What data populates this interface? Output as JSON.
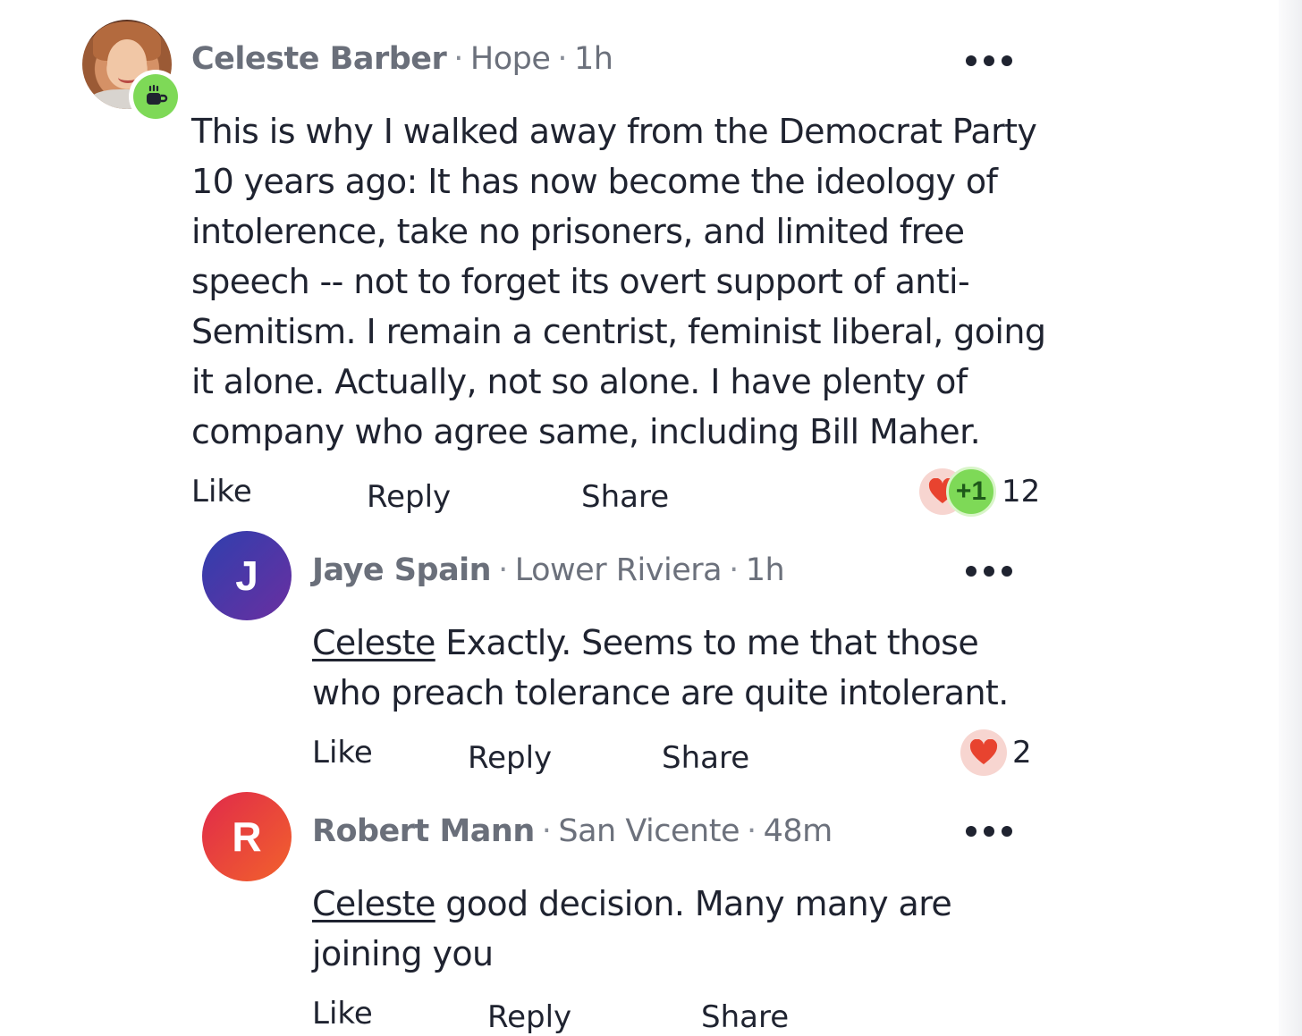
{
  "colors": {
    "text": "#1f2330",
    "meta": "#6c717c",
    "badge_green": "#7ed957",
    "avatar_purple": "#3a3aa8",
    "avatar_red": "#f0473d",
    "heart": "#e8432f"
  },
  "comments": [
    {
      "author": "Celeste Barber",
      "location": "Hope",
      "time": "1h",
      "badge_icon": "coffee-cup-icon",
      "lines": [
        "This is why I walked away from the Democrat Party",
        "10 years ago: It has now become the ideology of",
        "intolerence, take no prisoners, and limited free",
        "speech -- not to forget its overt support of anti-",
        "Semitism. I remain a centrist, feminist liberal, going",
        "it alone. Actually, not so alone. I have plenty of",
        "company who agree same, including Bill Maher."
      ],
      "actions": {
        "like": "Like",
        "reply": "Reply",
        "share": "Share"
      },
      "reaction_badge": "+1",
      "reaction_count": "12"
    },
    {
      "author": "Jaye Spain",
      "initial": "J",
      "location": "Lower Riviera",
      "time": "1h",
      "mention": "Celeste",
      "line1_rest": " Exactly. Seems to me that those",
      "line2": "who preach tolerance are quite intolerant.",
      "actions": {
        "like": "Like",
        "reply": "Reply",
        "share": "Share"
      },
      "reaction_count": "2"
    },
    {
      "author": "Robert Mann",
      "initial": "R",
      "location": "San Vicente",
      "time": "48m",
      "mention": "Celeste",
      "line1_rest": " good decision. Many many are",
      "line2": "joining you",
      "actions": {
        "like": "Like",
        "reply": "Reply",
        "share": "Share"
      }
    }
  ],
  "separator": "·"
}
